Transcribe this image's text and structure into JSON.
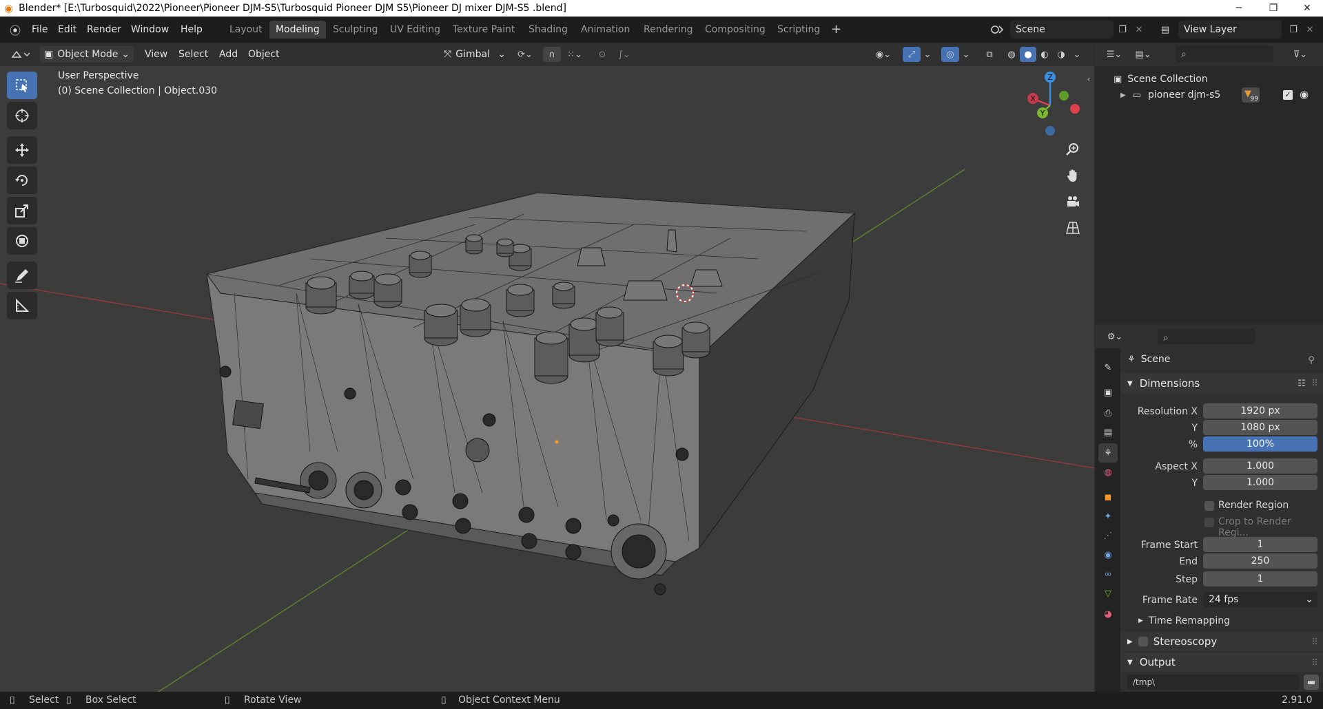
{
  "titlebar": {
    "title": "Blender* [E:\\Turbosquid\\2022\\Pioneer\\Pioneer DJM-S5\\Turbosquid Pioneer DJM S5\\Pioneer  DJ mixer DJM-S5 .blend]",
    "minimize": "─",
    "maximize": "❐",
    "close": "✕"
  },
  "menu": [
    "File",
    "Edit",
    "Render",
    "Window",
    "Help"
  ],
  "workspaces": [
    {
      "label": "Layout",
      "active": false
    },
    {
      "label": "Modeling",
      "active": true
    },
    {
      "label": "Sculpting",
      "active": false
    },
    {
      "label": "UV Editing",
      "active": false
    },
    {
      "label": "Texture Paint",
      "active": false
    },
    {
      "label": "Shading",
      "active": false
    },
    {
      "label": "Animation",
      "active": false
    },
    {
      "label": "Rendering",
      "active": false
    },
    {
      "label": "Compositing",
      "active": false
    },
    {
      "label": "Scripting",
      "active": false
    }
  ],
  "add_workspace": "+",
  "scene_field": "Scene",
  "view_layer_field": "View Layer",
  "viewport_header": {
    "mode": "Object Mode",
    "view": "View",
    "select": "Select",
    "add": "Add",
    "object": "Object",
    "orientation": "Gimbal"
  },
  "viewport": {
    "perspective": "User Perspective",
    "context": "(0) Scene Collection | Object.030",
    "gizmo": {
      "x": "X",
      "y": "Y",
      "z": "Z"
    },
    "colors": {
      "x": "#e0405c",
      "y": "#7ab530",
      "z": "#3d8fe0",
      "grid_x": "#8e3a3f",
      "grid_y": "#5c7f2c"
    }
  },
  "outliner": {
    "root": "Scene Collection",
    "items": [
      {
        "label": "pioneer djm-s5",
        "badge": "99"
      }
    ]
  },
  "properties": {
    "context": "Scene",
    "dimensions": {
      "title": "Dimensions",
      "resolution_x_label": "Resolution X",
      "resolution_x": "1920 px",
      "resolution_y_label": "Y",
      "resolution_y": "1080 px",
      "percent_label": "%",
      "percent": "100%",
      "aspect_x_label": "Aspect X",
      "aspect_x": "1.000",
      "aspect_y_label": "Y",
      "aspect_y": "1.000",
      "render_region": "Render Region",
      "crop_region": "Crop to Render Regi...",
      "frame_start_label": "Frame Start",
      "frame_start": "1",
      "frame_end_label": "End",
      "frame_end": "250",
      "frame_step_label": "Step",
      "frame_step": "1",
      "frame_rate_label": "Frame Rate",
      "frame_rate": "24 fps",
      "time_remapping": "Time Remapping"
    },
    "stereoscopy": "Stereoscopy",
    "output": "Output",
    "output_path": "/tmp\\"
  },
  "statusbar": {
    "select": "Select",
    "box_select": "Box Select",
    "rotate_view": "Rotate View",
    "context_menu": "Object Context Menu",
    "version": "2.91.0"
  },
  "accent": "#4772b3"
}
